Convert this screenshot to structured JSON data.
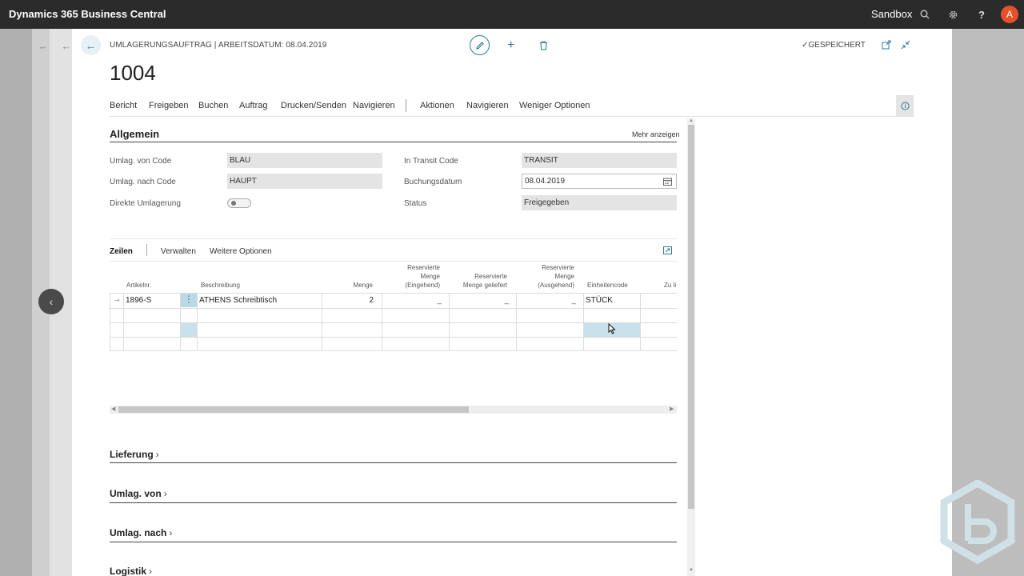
{
  "app": {
    "brand": "Dynamics 365 Business Central",
    "environment": "Sandbox",
    "avatar_initial": "A"
  },
  "header": {
    "page_title": "UMLAGERUNGSAUFTRAG | ARBEITSDATUM: 08.04.2019",
    "record_no": "1004",
    "saved_status": "GESPEICHERT"
  },
  "actions": [
    "Bericht",
    "Freigeben",
    "Buchen",
    "Auftrag",
    "Drucken/Senden",
    "Navigieren",
    "Aktionen",
    "Navigieren",
    "Weniger Optionen"
  ],
  "general": {
    "title": "Allgemein",
    "more_link": "Mehr anzeigen",
    "fields": {
      "from_code_label": "Umlag. von Code",
      "from_code_value": "BLAU",
      "to_code_label": "Umlag. nach Code",
      "to_code_value": "HAUPT",
      "direct_label": "Direkte Umlagerung",
      "transit_label": "In Transit Code",
      "transit_value": "TRANSIT",
      "posting_label": "Buchungsdatum",
      "posting_value": "08.04.2019",
      "status_label": "Status",
      "status_value": "Freigegeben"
    }
  },
  "lines": {
    "tabs": [
      "Zeilen",
      "Verwalten",
      "Weitere Optionen"
    ],
    "columns": {
      "item_no": "Artikelnr.",
      "description": "Beschreibung",
      "quantity": "Menge",
      "res_in": [
        "Reservierte",
        "Menge",
        "(Eingehend)"
      ],
      "res_shipped": [
        "Reservierte",
        "Menge geliefert"
      ],
      "res_out": [
        "Reservierte",
        "Menge",
        "(Ausgehend)"
      ],
      "unit": "Einheitencode",
      "extra": "Zu li"
    },
    "rows": [
      {
        "item_no": "1896-S",
        "description": "ATHENS Schreibtisch",
        "quantity": "2",
        "res_in": "_",
        "res_shipped": "_",
        "res_out": "_",
        "unit": "STÜCK"
      }
    ]
  },
  "fasttabs": [
    "Lieferung",
    "Umlag. von",
    "Umlag. nach",
    "Logistik"
  ],
  "icons": {
    "back": "arrow-left-icon",
    "edit": "pencil-icon",
    "add": "plus-icon",
    "delete": "trash-icon",
    "popout": "open-new-window-icon",
    "collapse": "collapse-icon",
    "info": "info-icon",
    "search": "search-icon",
    "settings": "gear-icon",
    "help": "help-icon",
    "calendar": "calendar-icon"
  }
}
